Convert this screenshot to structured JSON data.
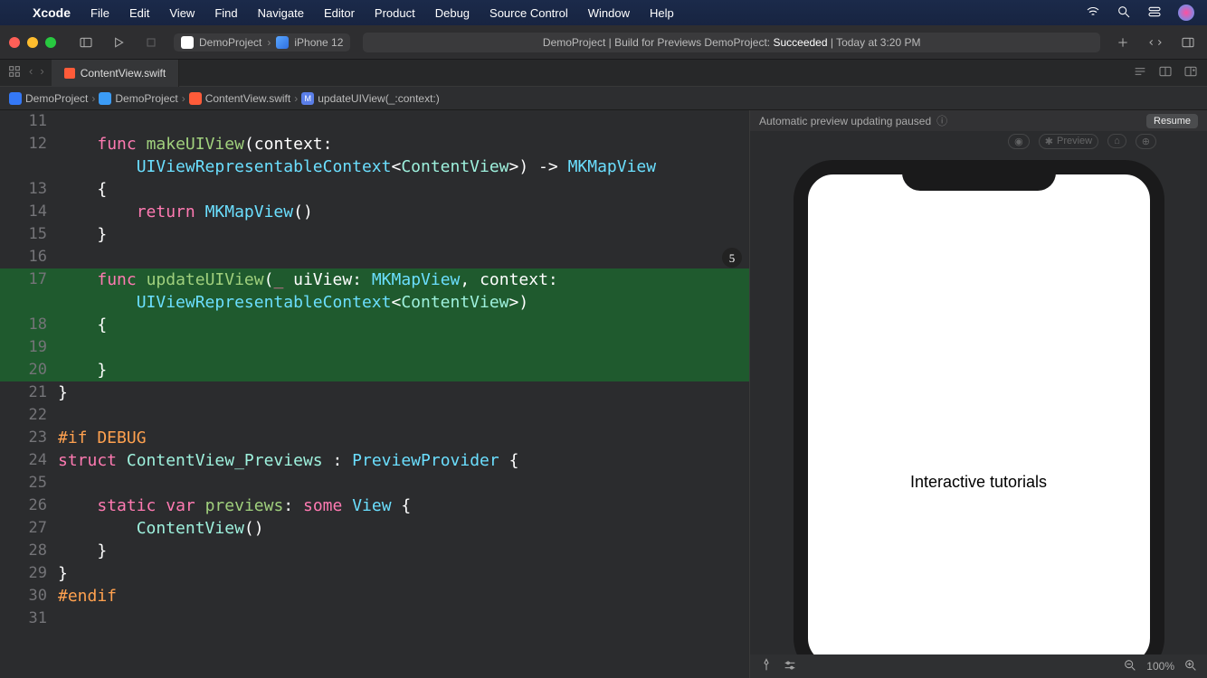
{
  "menubar": {
    "app": "Xcode",
    "items": [
      "File",
      "Edit",
      "View",
      "Find",
      "Navigate",
      "Editor",
      "Product",
      "Debug",
      "Source Control",
      "Window",
      "Help"
    ]
  },
  "titlebar": {
    "scheme_project": "DemoProject",
    "scheme_device": "iPhone 12",
    "status_prefix": "DemoProject | Build for Previews DemoProject: ",
    "status_result": "Succeeded",
    "status_time": " | Today at 3:20 PM"
  },
  "tabs": {
    "active_file": "ContentView.swift"
  },
  "breadcrumb": {
    "project": "DemoProject",
    "folder": "DemoProject",
    "file": "ContentView.swift",
    "symbol": "updateUIView(_:context:)"
  },
  "code": {
    "lines": [
      11,
      12,
      13,
      14,
      15,
      16,
      17,
      18,
      19,
      20,
      21,
      22,
      23,
      24,
      25,
      26,
      27,
      28,
      29,
      30,
      31
    ],
    "l12a": "    func makeUIView(context:",
    "l12b_type1": "UIViewRepresentableContext",
    "l12b_type2": "ContentView",
    "l12b_ret": "MKMapView",
    "l14_ret": "return ",
    "l14_type": "MKMapView",
    "l17_fn": "updateUIView",
    "l17_type": "MKMapView",
    "l17b_type1": "UIViewRepresentableContext",
    "l17b_type2": "ContentView",
    "l23": "#if DEBUG",
    "l24_name": "ContentView_Previews",
    "l24_proto": "PreviewProvider",
    "l26_var": "previews",
    "l26_some": "some",
    "l26_view": "View",
    "l27_call": "ContentView",
    "l30": "#endif",
    "badge": "5"
  },
  "preview": {
    "status": "Automatic preview updating paused",
    "resume": "Resume",
    "ghost_label": "Preview",
    "phone_text": "Interactive tutorials",
    "zoom": "100%"
  }
}
